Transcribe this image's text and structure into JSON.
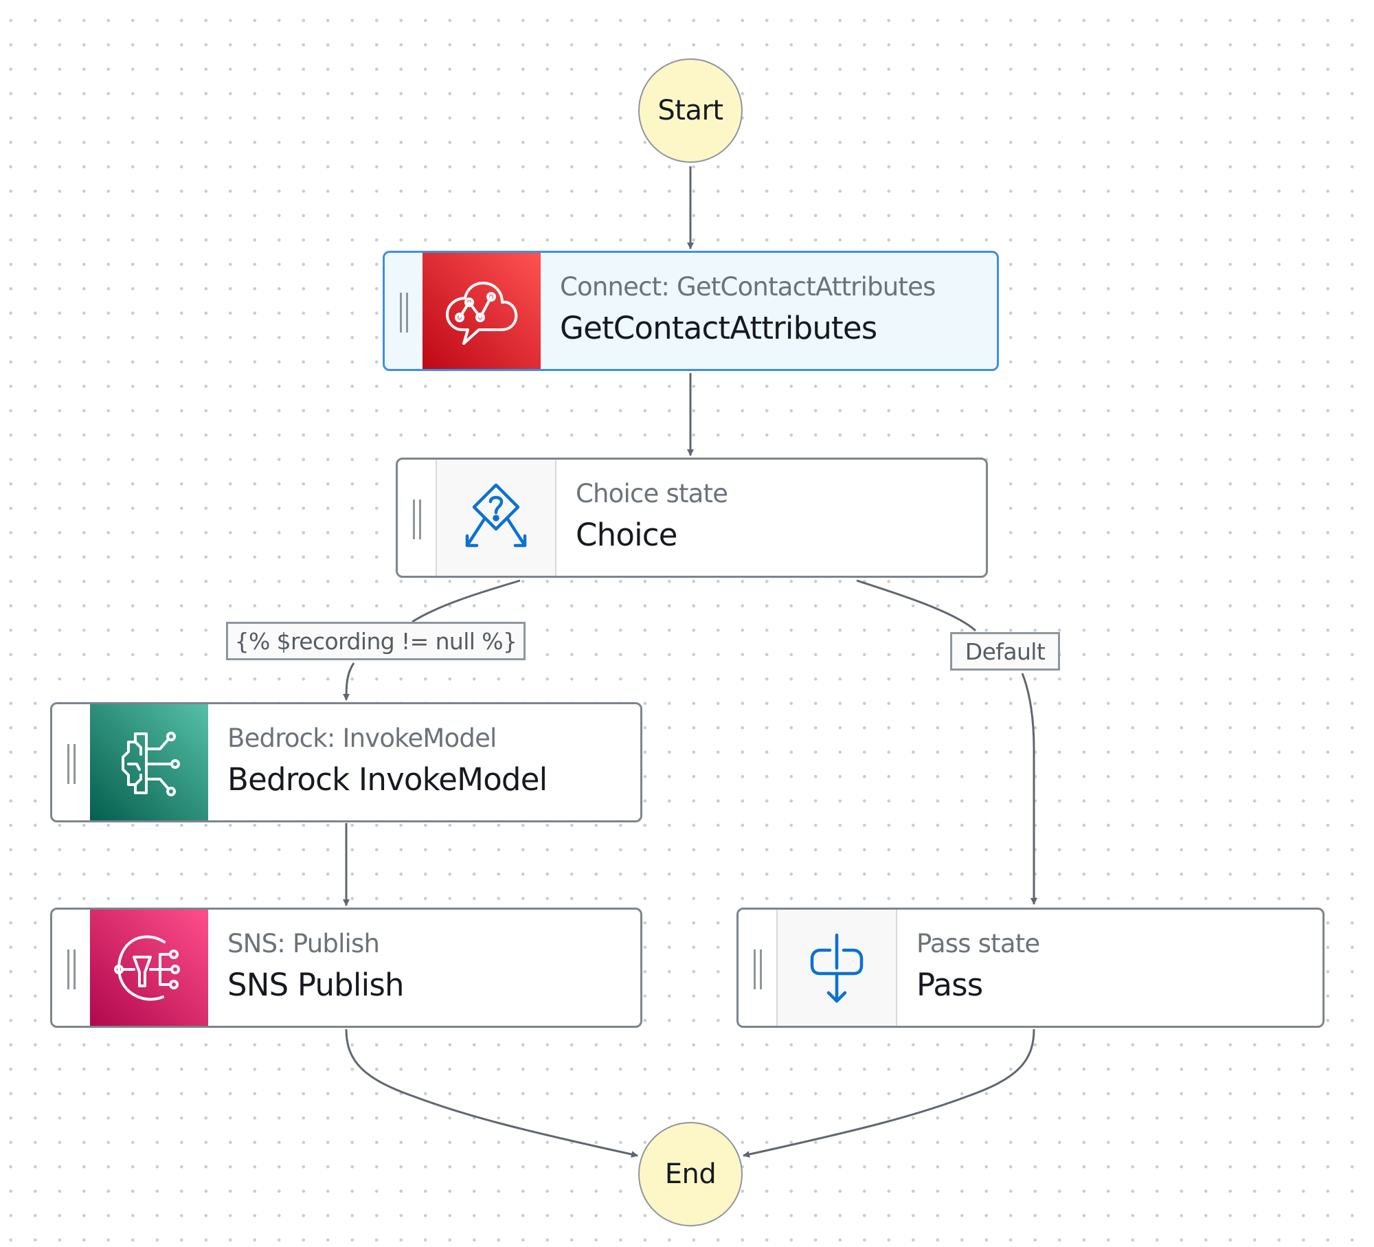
{
  "diagram": {
    "kind": "state-machine-workflow",
    "start": {
      "label": "Start"
    },
    "end": {
      "label": "End"
    },
    "states": [
      {
        "id": "get-contact-attributes",
        "type_label": "Connect: GetContactAttributes",
        "name": "GetContactAttributes",
        "icon": "connect-icon",
        "selected": true
      },
      {
        "id": "choice",
        "type_label": "Choice state",
        "name": "Choice",
        "icon": "choice-icon",
        "selected": false
      },
      {
        "id": "bedrock-invoke-model",
        "type_label": "Bedrock: InvokeModel",
        "name": "Bedrock InvokeModel",
        "icon": "bedrock-icon",
        "selected": false
      },
      {
        "id": "sns-publish",
        "type_label": "SNS: Publish",
        "name": "SNS Publish",
        "icon": "sns-icon",
        "selected": false
      },
      {
        "id": "pass",
        "type_label": "Pass state",
        "name": "Pass",
        "icon": "pass-icon",
        "selected": false
      }
    ],
    "edges": [
      {
        "from": "start",
        "to": "get-contact-attributes",
        "label": ""
      },
      {
        "from": "get-contact-attributes",
        "to": "choice",
        "label": ""
      },
      {
        "from": "choice",
        "to": "bedrock-invoke-model",
        "label": "{% $recording != null %}"
      },
      {
        "from": "choice",
        "to": "pass",
        "label": "Default"
      },
      {
        "from": "bedrock-invoke-model",
        "to": "sns-publish",
        "label": ""
      },
      {
        "from": "sns-publish",
        "to": "end",
        "label": ""
      },
      {
        "from": "pass",
        "to": "end",
        "label": ""
      }
    ]
  },
  "colors": {
    "selection_border": "#3d8ee8",
    "terminal_fill": "#fdf7c7",
    "connect_tile": "#dd344c",
    "bedrock_tile": "#01a88d",
    "sns_tile": "#e7157b",
    "flow_icon": "#0972d3",
    "edge": "#5f6670"
  }
}
